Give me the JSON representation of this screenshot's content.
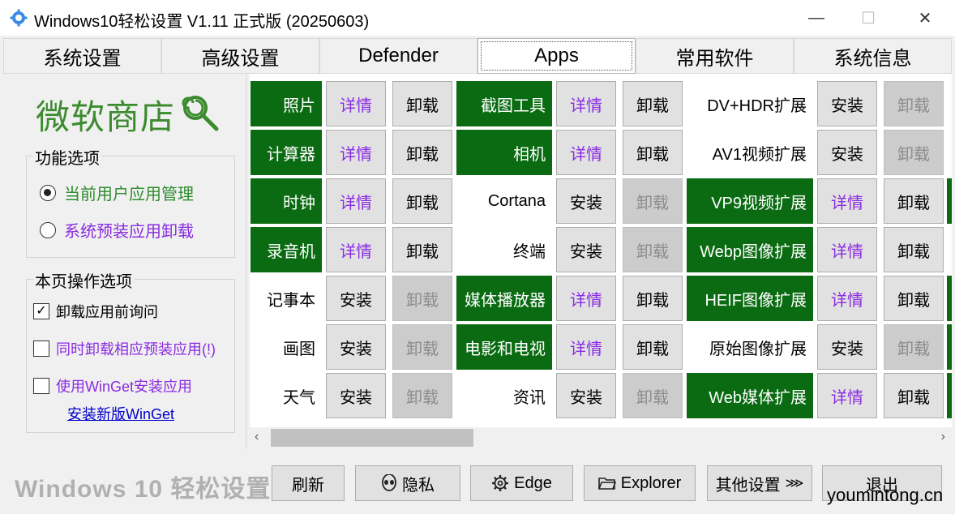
{
  "window": {
    "title": "Windows10轻松设置 V1.11 正式版 (20250603)",
    "minimize": "—",
    "maximize": "☐",
    "close": "✕"
  },
  "tabs": [
    {
      "label": "系统设置"
    },
    {
      "label": "高级设置"
    },
    {
      "label": "Defender"
    },
    {
      "label": "Apps",
      "active": true
    },
    {
      "label": "常用软件"
    },
    {
      "label": "系统信息"
    }
  ],
  "store": {
    "title": "微软商店",
    "icon": "lollipop-icon"
  },
  "options": {
    "legend": "功能选项",
    "radio1": "当前用户应用管理",
    "radio2": "系统预装应用卸载",
    "selected": "当前用户应用管理"
  },
  "page_ops": {
    "legend": "本页操作选项",
    "check1": "卸载应用前询问",
    "check1_checked": true,
    "check2": "同时卸载相应预装应用(!)",
    "check3": "使用WinGet安装应用",
    "link": "安装新版WinGet"
  },
  "apps": {
    "col1": [
      {
        "name": "照片",
        "installed": true,
        "btn1": "详情",
        "btn2": "卸载"
      },
      {
        "name": "计算器",
        "installed": true,
        "btn1": "详情",
        "btn2": "卸载"
      },
      {
        "name": "时钟",
        "installed": true,
        "btn1": "详情",
        "btn2": "卸载"
      },
      {
        "name": "录音机",
        "installed": true,
        "btn1": "详情",
        "btn2": "卸载"
      },
      {
        "name": "记事本",
        "installed": false,
        "btn1": "安装",
        "btn2": "卸载"
      },
      {
        "name": "画图",
        "installed": false,
        "btn1": "安装",
        "btn2": "卸载"
      },
      {
        "name": "天气",
        "installed": false,
        "btn1": "安装",
        "btn2": "卸载"
      }
    ],
    "col2": [
      {
        "name": "截图工具",
        "installed": true,
        "btn1": "详情",
        "btn2": "卸载"
      },
      {
        "name": "相机",
        "installed": true,
        "btn1": "详情",
        "btn2": "卸载"
      },
      {
        "name": "Cortana",
        "installed": false,
        "btn1": "安装",
        "btn2": "卸载"
      },
      {
        "name": "终端",
        "installed": false,
        "btn1": "安装",
        "btn2": "卸载"
      },
      {
        "name": "媒体播放器",
        "installed": true,
        "btn1": "详情",
        "btn2": "卸载"
      },
      {
        "name": "电影和电视",
        "installed": true,
        "btn1": "详情",
        "btn2": "卸载"
      },
      {
        "name": "资讯",
        "installed": false,
        "btn1": "安装",
        "btn2": "卸载"
      }
    ],
    "col3": [
      {
        "name": "DV+HDR扩展",
        "installed": false,
        "btn1": "安装",
        "btn2": "卸载"
      },
      {
        "name": "AV1视频扩展",
        "installed": false,
        "btn1": "安装",
        "btn2": "卸载"
      },
      {
        "name": "VP9视频扩展",
        "installed": true,
        "btn1": "详情",
        "btn2": "卸载"
      },
      {
        "name": "Webp图像扩展",
        "installed": true,
        "btn1": "详情",
        "btn2": "卸载"
      },
      {
        "name": "HEIF图像扩展",
        "installed": true,
        "btn1": "详情",
        "btn2": "卸载"
      },
      {
        "name": "原始图像扩展",
        "installed": false,
        "btn1": "安装",
        "btn2": "卸载"
      },
      {
        "name": "Web媒体扩展",
        "installed": true,
        "btn1": "详情",
        "btn2": "卸载"
      }
    ]
  },
  "bottom": {
    "title": "Windows 10 轻松设置",
    "refresh": "刷新",
    "privacy": "隐私",
    "edge": "Edge",
    "explorer": "Explorer",
    "more": "其他设置",
    "exit": "退出",
    "watermark": "youmintong.cn"
  },
  "colors": {
    "installed_bg": "#0a6b12",
    "detail_text": "#8a2be2",
    "store_green": "#3d8b2f"
  }
}
